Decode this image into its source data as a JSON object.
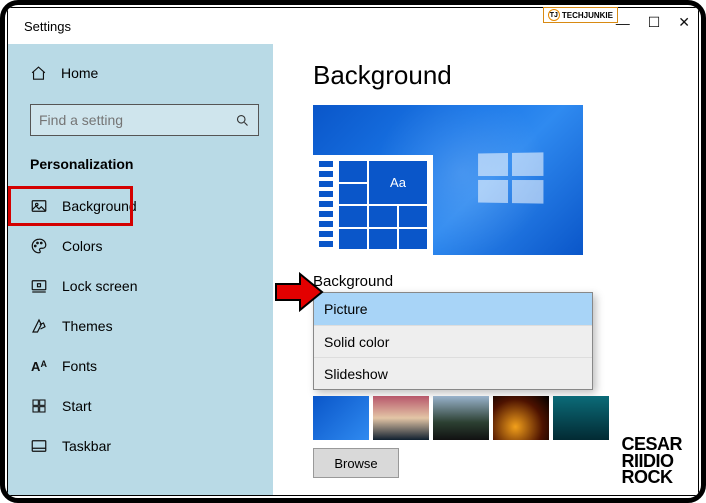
{
  "window": {
    "title": "Settings"
  },
  "badge": {
    "brand_abbrev": "TJ",
    "brand": "TECHJUNKIE"
  },
  "sidebar": {
    "home": "Home",
    "search_placeholder": "Find a setting",
    "category": "Personalization",
    "items": [
      {
        "label": "Background"
      },
      {
        "label": "Colors"
      },
      {
        "label": "Lock screen"
      },
      {
        "label": "Themes"
      },
      {
        "label": "Fonts"
      },
      {
        "label": "Start"
      },
      {
        "label": "Taskbar"
      }
    ]
  },
  "main": {
    "heading": "Background",
    "preview_sample": "Aa",
    "dropdown_label": "Background",
    "options": [
      {
        "label": "Picture"
      },
      {
        "label": "Solid color"
      },
      {
        "label": "Slideshow"
      }
    ],
    "browse": "Browse"
  },
  "watermark": {
    "line1": "CESAR",
    "line2": "RIIDIO",
    "line3": "ROCK"
  }
}
